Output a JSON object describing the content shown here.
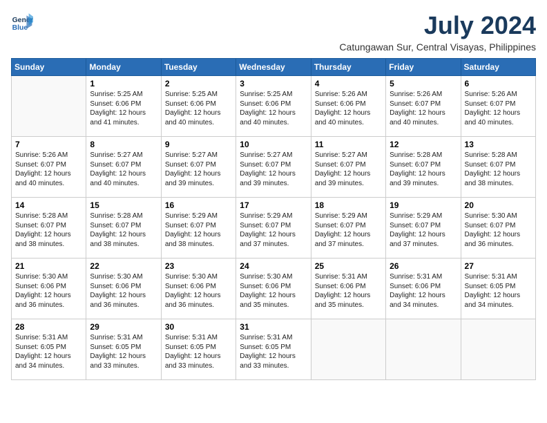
{
  "logo": {
    "line1": "General",
    "line2": "Blue"
  },
  "title": "July 2024",
  "location": "Catungawan Sur, Central Visayas, Philippines",
  "weekdays": [
    "Sunday",
    "Monday",
    "Tuesday",
    "Wednesday",
    "Thursday",
    "Friday",
    "Saturday"
  ],
  "weeks": [
    [
      {
        "day": "",
        "info": ""
      },
      {
        "day": "1",
        "info": "Sunrise: 5:25 AM\nSunset: 6:06 PM\nDaylight: 12 hours\nand 41 minutes."
      },
      {
        "day": "2",
        "info": "Sunrise: 5:25 AM\nSunset: 6:06 PM\nDaylight: 12 hours\nand 40 minutes."
      },
      {
        "day": "3",
        "info": "Sunrise: 5:25 AM\nSunset: 6:06 PM\nDaylight: 12 hours\nand 40 minutes."
      },
      {
        "day": "4",
        "info": "Sunrise: 5:26 AM\nSunset: 6:06 PM\nDaylight: 12 hours\nand 40 minutes."
      },
      {
        "day": "5",
        "info": "Sunrise: 5:26 AM\nSunset: 6:07 PM\nDaylight: 12 hours\nand 40 minutes."
      },
      {
        "day": "6",
        "info": "Sunrise: 5:26 AM\nSunset: 6:07 PM\nDaylight: 12 hours\nand 40 minutes."
      }
    ],
    [
      {
        "day": "7",
        "info": "Sunrise: 5:26 AM\nSunset: 6:07 PM\nDaylight: 12 hours\nand 40 minutes."
      },
      {
        "day": "8",
        "info": "Sunrise: 5:27 AM\nSunset: 6:07 PM\nDaylight: 12 hours\nand 40 minutes."
      },
      {
        "day": "9",
        "info": "Sunrise: 5:27 AM\nSunset: 6:07 PM\nDaylight: 12 hours\nand 39 minutes."
      },
      {
        "day": "10",
        "info": "Sunrise: 5:27 AM\nSunset: 6:07 PM\nDaylight: 12 hours\nand 39 minutes."
      },
      {
        "day": "11",
        "info": "Sunrise: 5:27 AM\nSunset: 6:07 PM\nDaylight: 12 hours\nand 39 minutes."
      },
      {
        "day": "12",
        "info": "Sunrise: 5:28 AM\nSunset: 6:07 PM\nDaylight: 12 hours\nand 39 minutes."
      },
      {
        "day": "13",
        "info": "Sunrise: 5:28 AM\nSunset: 6:07 PM\nDaylight: 12 hours\nand 38 minutes."
      }
    ],
    [
      {
        "day": "14",
        "info": "Sunrise: 5:28 AM\nSunset: 6:07 PM\nDaylight: 12 hours\nand 38 minutes."
      },
      {
        "day": "15",
        "info": "Sunrise: 5:28 AM\nSunset: 6:07 PM\nDaylight: 12 hours\nand 38 minutes."
      },
      {
        "day": "16",
        "info": "Sunrise: 5:29 AM\nSunset: 6:07 PM\nDaylight: 12 hours\nand 38 minutes."
      },
      {
        "day": "17",
        "info": "Sunrise: 5:29 AM\nSunset: 6:07 PM\nDaylight: 12 hours\nand 37 minutes."
      },
      {
        "day": "18",
        "info": "Sunrise: 5:29 AM\nSunset: 6:07 PM\nDaylight: 12 hours\nand 37 minutes."
      },
      {
        "day": "19",
        "info": "Sunrise: 5:29 AM\nSunset: 6:07 PM\nDaylight: 12 hours\nand 37 minutes."
      },
      {
        "day": "20",
        "info": "Sunrise: 5:30 AM\nSunset: 6:07 PM\nDaylight: 12 hours\nand 36 minutes."
      }
    ],
    [
      {
        "day": "21",
        "info": "Sunrise: 5:30 AM\nSunset: 6:06 PM\nDaylight: 12 hours\nand 36 minutes."
      },
      {
        "day": "22",
        "info": "Sunrise: 5:30 AM\nSunset: 6:06 PM\nDaylight: 12 hours\nand 36 minutes."
      },
      {
        "day": "23",
        "info": "Sunrise: 5:30 AM\nSunset: 6:06 PM\nDaylight: 12 hours\nand 36 minutes."
      },
      {
        "day": "24",
        "info": "Sunrise: 5:30 AM\nSunset: 6:06 PM\nDaylight: 12 hours\nand 35 minutes."
      },
      {
        "day": "25",
        "info": "Sunrise: 5:31 AM\nSunset: 6:06 PM\nDaylight: 12 hours\nand 35 minutes."
      },
      {
        "day": "26",
        "info": "Sunrise: 5:31 AM\nSunset: 6:06 PM\nDaylight: 12 hours\nand 34 minutes."
      },
      {
        "day": "27",
        "info": "Sunrise: 5:31 AM\nSunset: 6:05 PM\nDaylight: 12 hours\nand 34 minutes."
      }
    ],
    [
      {
        "day": "28",
        "info": "Sunrise: 5:31 AM\nSunset: 6:05 PM\nDaylight: 12 hours\nand 34 minutes."
      },
      {
        "day": "29",
        "info": "Sunrise: 5:31 AM\nSunset: 6:05 PM\nDaylight: 12 hours\nand 33 minutes."
      },
      {
        "day": "30",
        "info": "Sunrise: 5:31 AM\nSunset: 6:05 PM\nDaylight: 12 hours\nand 33 minutes."
      },
      {
        "day": "31",
        "info": "Sunrise: 5:31 AM\nSunset: 6:05 PM\nDaylight: 12 hours\nand 33 minutes."
      },
      {
        "day": "",
        "info": ""
      },
      {
        "day": "",
        "info": ""
      },
      {
        "day": "",
        "info": ""
      }
    ]
  ]
}
